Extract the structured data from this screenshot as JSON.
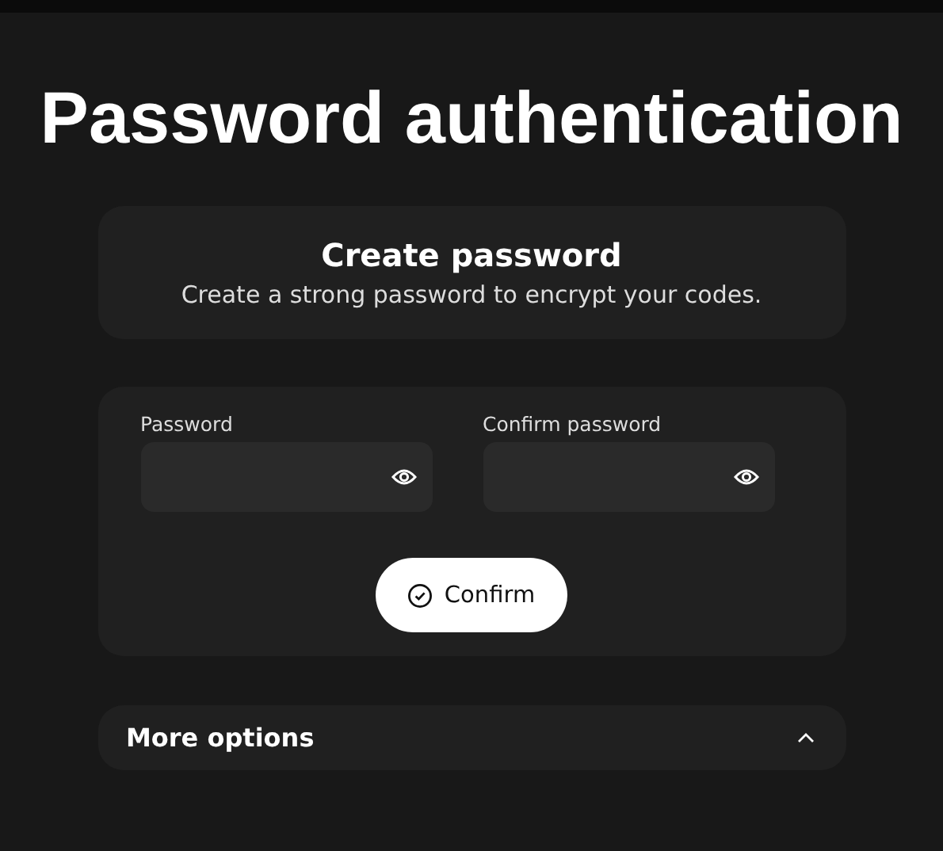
{
  "title": "Password authentication",
  "header_card": {
    "title": "Create password",
    "subtitle": "Create a strong password to encrypt your codes."
  },
  "fields": [
    {
      "label": "Password"
    },
    {
      "label": "Confirm password"
    }
  ],
  "confirm_button": {
    "label": "Confirm"
  },
  "more_options": {
    "label": "More options"
  }
}
